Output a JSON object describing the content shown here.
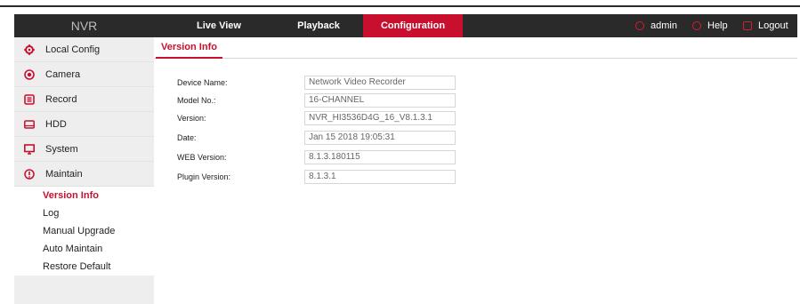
{
  "header": {
    "logo": "NVR",
    "nav": [
      {
        "label": "Live View"
      },
      {
        "label": "Playback"
      },
      {
        "label": "Configuration"
      }
    ],
    "user": "admin",
    "help": "Help",
    "logout": "Logout"
  },
  "colors": {
    "accent": "#c8102e",
    "topbar": "#2a2a2a",
    "sidebar": "#eeeeee"
  },
  "sidebar": {
    "items": [
      {
        "label": "Local Config",
        "icon": "local-config-icon"
      },
      {
        "label": "Camera",
        "icon": "camera-icon"
      },
      {
        "label": "Record",
        "icon": "record-icon"
      },
      {
        "label": "HDD",
        "icon": "hdd-icon"
      },
      {
        "label": "System",
        "icon": "system-icon"
      },
      {
        "label": "Maintain",
        "icon": "maintain-icon"
      }
    ],
    "submenu": [
      {
        "label": "Version Info"
      },
      {
        "label": "Log"
      },
      {
        "label": "Manual Upgrade"
      },
      {
        "label": "Auto Maintain"
      },
      {
        "label": "Restore Default"
      }
    ]
  },
  "main": {
    "tab": "Version Info",
    "fields": [
      {
        "label": "Device Name:",
        "value": "Network Video Recorder"
      },
      {
        "label": "Model No.:",
        "value": "16-CHANNEL"
      },
      {
        "label": "Version:",
        "value": "NVR_HI3536D4G_16_V8.1.3.1"
      },
      {
        "label": "Date:",
        "value": "Jan 15 2018  19:05:31"
      },
      {
        "label": "WEB Version:",
        "value": "8.1.3.180115"
      },
      {
        "label": "Plugin Version:",
        "value": "8.1.3.1"
      }
    ]
  }
}
